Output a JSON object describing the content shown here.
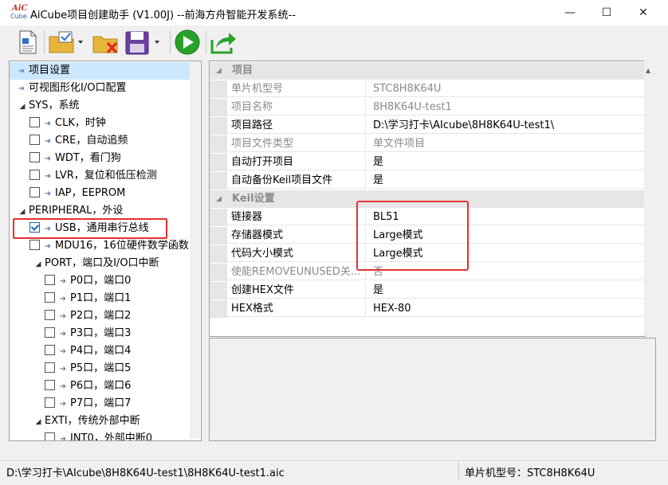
{
  "window": {
    "title": "AiCube项目创建助手 (V1.00J) --前海方舟智能开发系统--",
    "logo_top": "AiC",
    "logo_bottom": "Cube",
    "minimize": "—",
    "maximize": "☐",
    "close": "✕"
  },
  "toolbar": {
    "items": [
      "new-project",
      "open-project",
      "close-project",
      "save-project",
      "run",
      "export"
    ]
  },
  "tree": {
    "items": [
      {
        "label": "项目设置",
        "type": "leaf",
        "selected": true
      },
      {
        "label": "可视图形化I/O口配置",
        "type": "leaf"
      },
      {
        "label": "SYS，系统",
        "type": "group"
      },
      {
        "label": "CLK，时钟",
        "type": "check",
        "checked": false
      },
      {
        "label": "CRE，自动追频",
        "type": "check",
        "checked": false
      },
      {
        "label": "WDT，看门狗",
        "type": "check",
        "checked": false
      },
      {
        "label": "LVR，复位和低压检测",
        "type": "check",
        "checked": false
      },
      {
        "label": "IAP，EEPROM",
        "type": "check",
        "checked": false
      },
      {
        "label": "PERIPHERAL，外设",
        "type": "group"
      },
      {
        "label": "USB，通用串行总线",
        "type": "check",
        "checked": true
      },
      {
        "label": "MDU16，16位硬件数学函数",
        "type": "check",
        "checked": false
      },
      {
        "label": "PORT，端口及I/O口中断",
        "type": "group2"
      },
      {
        "label": "P0口，端口0",
        "type": "port",
        "checked": false
      },
      {
        "label": "P1口，端口1",
        "type": "port",
        "checked": false
      },
      {
        "label": "P2口，端口2",
        "type": "port",
        "checked": false
      },
      {
        "label": "P3口，端口3",
        "type": "port",
        "checked": false
      },
      {
        "label": "P4口，端口4",
        "type": "port",
        "checked": false
      },
      {
        "label": "P5口，端口5",
        "type": "port",
        "checked": false
      },
      {
        "label": "P6口，端口6",
        "type": "port",
        "checked": false
      },
      {
        "label": "P7口，端口7",
        "type": "port",
        "checked": false
      },
      {
        "label": "EXTI，传统外部中断",
        "type": "group2"
      },
      {
        "label": "INT0，外部中断0",
        "type": "port",
        "checked": false
      }
    ]
  },
  "grid": {
    "categories": [
      {
        "name": "项目",
        "rows": [
          {
            "key": "单片机型号",
            "value": "STC8H8K64U",
            "disabled": true
          },
          {
            "key": "项目名称",
            "value": "8H8K64U-test1",
            "disabled": true
          },
          {
            "key": "项目路径",
            "value": "D:\\学习打卡\\AIcube\\8H8K64U-test1\\",
            "disabled": false
          },
          {
            "key": "项目文件类型",
            "value": "单文件项目",
            "disabled": true
          },
          {
            "key": "自动打开项目",
            "value": "是",
            "disabled": false
          },
          {
            "key": "自动备份Keil项目文件",
            "value": "是",
            "disabled": false
          }
        ]
      },
      {
        "name": "Keil设置",
        "rows": [
          {
            "key": "链接器",
            "value": "BL51",
            "disabled": false
          },
          {
            "key": "存储器模式",
            "value": "Large模式",
            "disabled": false
          },
          {
            "key": "代码大小模式",
            "value": "Large模式",
            "disabled": false
          },
          {
            "key": "使能REMOVEUNUSED关...",
            "value": "否",
            "disabled": true
          },
          {
            "key": "创建HEX文件",
            "value": "是",
            "disabled": false
          },
          {
            "key": "HEX格式",
            "value": "HEX-80",
            "disabled": false
          }
        ]
      }
    ]
  },
  "status": {
    "path": "D:\\学习打卡\\AIcube\\8H8K64U-test1\\8H8K64U-test1.aic",
    "mcu_label": "单片机型号：STC8H8K64U"
  },
  "colors": {
    "highlight": "#e53030",
    "selection": "#cce8ff",
    "run_green": "#2aa12a"
  }
}
